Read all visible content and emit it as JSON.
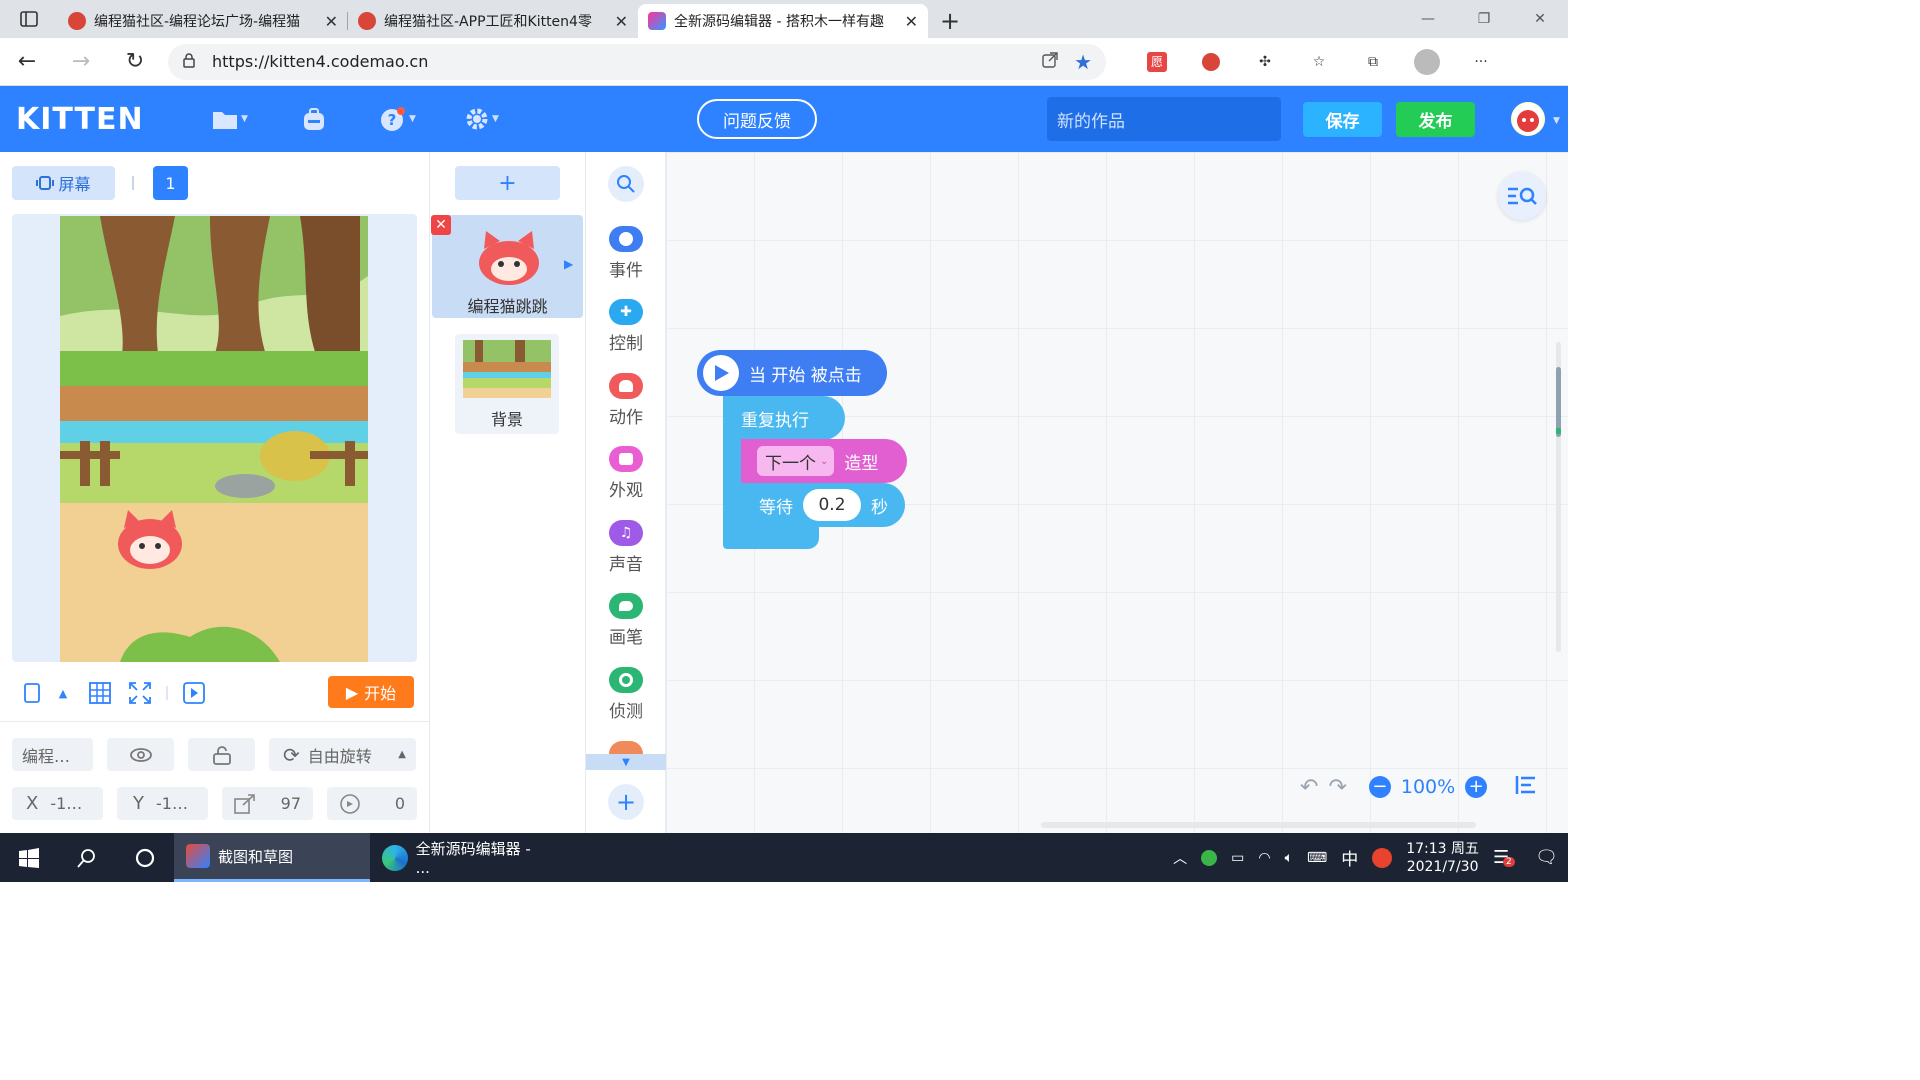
{
  "browser": {
    "tabs": [
      {
        "title": "编程猫社区-编程论坛广场-编程猫",
        "active": false
      },
      {
        "title": "编程猫社区-APP工匠和Kitten4零",
        "active": false
      },
      {
        "title": "全新源码编辑器 - 搭积木一样有趣",
        "active": true
      }
    ],
    "new_tab": "+",
    "url": "https://kitten4.codemao.cn",
    "ext_badge": "愿"
  },
  "app": {
    "logo": "KITTEN",
    "feedback": "问题反馈",
    "project_name_placeholder": "新的作品",
    "save": "保存",
    "publish": "发布"
  },
  "stage": {
    "screen_button": "屏幕",
    "page_number": "1",
    "start_button": "开始",
    "sprite_name": "编程…",
    "rotation_mode": "自由旋转",
    "x_label": "X",
    "x_value": "-1…",
    "y_label": "Y",
    "y_value": "-1…",
    "size_value": "97",
    "direction_value": "0"
  },
  "sprites": {
    "add": "+",
    "items": [
      {
        "name": "编程猫跳跳",
        "selected": true
      },
      {
        "name": "背景",
        "selected": false
      }
    ]
  },
  "categories": [
    {
      "label": "事件",
      "color": "#3f7df3"
    },
    {
      "label": "控制",
      "color": "#2aa8f0"
    },
    {
      "label": "动作",
      "color": "#f05a5a"
    },
    {
      "label": "外观",
      "color": "#e95fd3"
    },
    {
      "label": "声音",
      "color": "#a05ae8"
    },
    {
      "label": "画笔",
      "color": "#2bb673"
    },
    {
      "label": "侦测",
      "color": "#2bb673"
    }
  ],
  "blocks": {
    "hat": "当 开始 被点击",
    "repeat": "重复执行",
    "looks_dropdown": "下一个",
    "looks_suffix": "造型",
    "wait_label": "等待",
    "wait_value": "0.2",
    "wait_unit": "秒"
  },
  "workspace": {
    "zoom": "100%"
  },
  "taskbar": {
    "apps": [
      {
        "label": "截图和草图",
        "active": true
      },
      {
        "label": "全新源码编辑器 - ...",
        "active": false
      }
    ],
    "ime": "中",
    "time": "17:13 周五",
    "date": "2021/7/30",
    "notify_count": "2"
  }
}
